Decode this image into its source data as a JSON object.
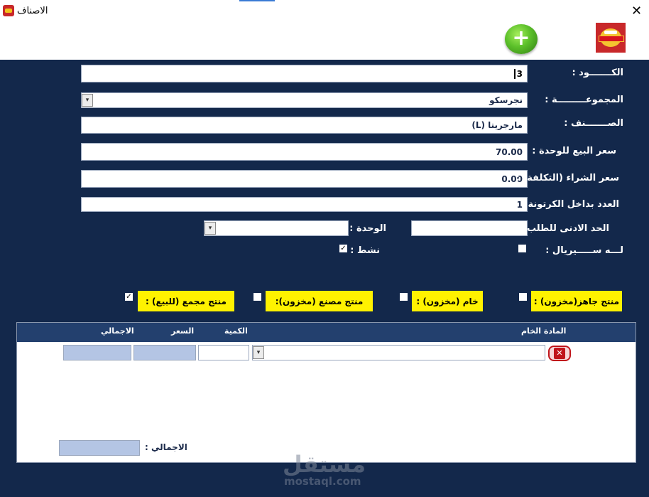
{
  "window": {
    "title": "الاصناف",
    "close": "✕"
  },
  "toolbar": {
    "add_icon_glyph": "+"
  },
  "form": {
    "code_label": "الكـــــــود :",
    "code_value": "3",
    "group_label": "المجموعـــــــــة :",
    "group_value": "نجرسكو",
    "item_label": "الصـــــــنف :",
    "item_value": "مارجريتا (L)",
    "sale_price_label": "سعر البيع للوحدة :",
    "sale_price_value": "70.00",
    "cost_price_label": "سعر الشراء (التكلفة) :",
    "cost_price_value": "0.00",
    "carton_count_label": "العدد بداخل الكرتونة :",
    "carton_count_value": "1",
    "min_order_label": "الحد الادنى للطلب :",
    "min_order_value": "",
    "unit_label": "الوحدة :",
    "unit_value": "",
    "serial_label": "لـــه ســـــيريال :",
    "serial_checked": false,
    "active_label": "نشط :",
    "active_checked": true
  },
  "product_types": [
    {
      "label": "منتج جاهز(مخزون) :",
      "checked": false
    },
    {
      "label": "خام (مخزون) :",
      "checked": false
    },
    {
      "label": "منتج مصنع (مخزون):",
      "checked": false
    },
    {
      "label": "منتج مجمع (للبيع) :",
      "checked": true
    }
  ],
  "grid": {
    "col_material": "المادة الخام",
    "col_qty": "الكمية",
    "col_price": "السعر",
    "col_total": "الاجمالي",
    "row": {
      "material": "",
      "qty": "",
      "price": "",
      "total": ""
    },
    "delete_glyph": "✕",
    "footer_total_label": "الاجمالي :",
    "footer_total_value": ""
  },
  "watermark": {
    "arabic": "مستقل",
    "latin": "mostaql.com"
  },
  "colors": {
    "background": "#13284b",
    "highlight": "#fff200",
    "total_cell": "#b4c5e4",
    "delete_red": "#c0151b"
  }
}
